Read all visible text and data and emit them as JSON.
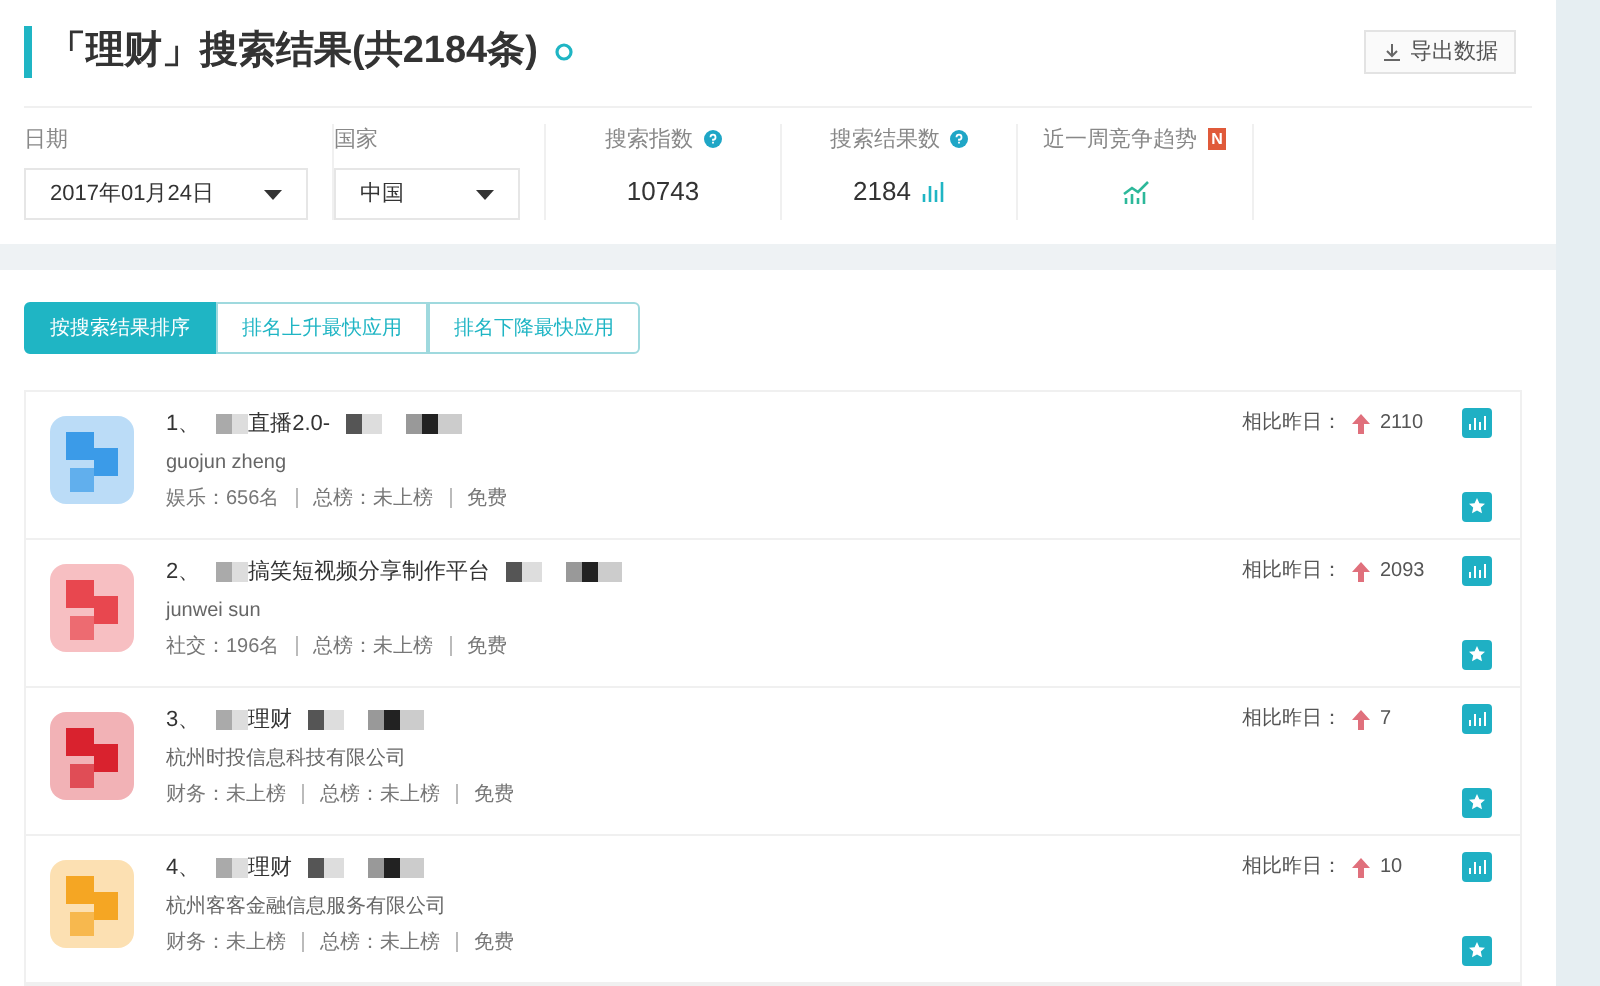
{
  "header": {
    "title": "「理财」搜索结果(共2184条)",
    "export_button": "导出数据"
  },
  "filters": [
    {
      "label": "日期",
      "value": "2017年01月24日"
    },
    {
      "label": "国家",
      "value": "中国"
    }
  ],
  "metrics": [
    {
      "kind": "index",
      "label": "搜索指数",
      "value": "10743"
    },
    {
      "kind": "results",
      "label": "搜索结果数",
      "value": "2184"
    },
    {
      "kind": "trend",
      "label": "近一周竞争趋势",
      "badge": "N"
    }
  ],
  "tabs": [
    {
      "label": "按搜索结果排序",
      "selected": true
    },
    {
      "label": "排名上升最快应用",
      "selected": false
    },
    {
      "label": "排名下降最快应用",
      "selected": false
    }
  ],
  "apps": [
    {
      "rank": "1、",
      "name": "直播2.0-",
      "developer": "guojun zheng",
      "category_rank": "娱乐：656名",
      "overall_rank": "总榜：未上榜",
      "price": "免费",
      "change_label": "相比昨日：",
      "change": "2110",
      "color": "#3b9be8"
    },
    {
      "rank": "2、",
      "name": "搞笑短视频分享制作平台",
      "developer": "junwei sun",
      "category_rank": "社交：196名",
      "overall_rank": "总榜：未上榜",
      "price": "免费",
      "change_label": "相比昨日：",
      "change": "2093",
      "color": "#e8474f"
    },
    {
      "rank": "3、",
      "name": "理财",
      "developer": "杭州时投信息科技有限公司",
      "category_rank": "财务：未上榜",
      "overall_rank": "总榜：未上榜",
      "price": "免费",
      "change_label": "相比昨日：",
      "change": "7",
      "color": "#d9222e"
    },
    {
      "rank": "4、",
      "name": "理财",
      "developer": "杭州客客金融信息服务有限公司",
      "category_rank": "财务：未上榜",
      "overall_rank": "总榜：未上榜",
      "price": "免费",
      "change_label": "相比昨日：",
      "change": "10",
      "color": "#f5a623"
    }
  ]
}
